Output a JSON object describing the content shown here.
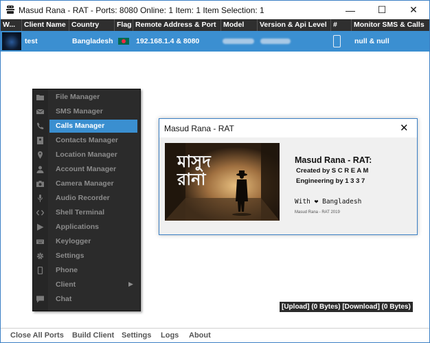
{
  "window": {
    "title": "Masud Rana - RAT - Ports: 8080 Online: 1 Item: 1 Item Selection: 1",
    "controls": {
      "minimize": "—",
      "maximize": "☐",
      "close": "✕"
    }
  },
  "table": {
    "columns": [
      "W...",
      "Client Name",
      "Country",
      "Flag",
      "Remote Address & Port",
      "Model",
      "Version & Api Level",
      "#",
      "Monitor SMS & Calls"
    ],
    "rows": [
      {
        "client_name": "test",
        "country": "Bangladesh",
        "remote": "192.168.1.4 & 8080",
        "monitor": "null & null"
      }
    ]
  },
  "context_menu": {
    "items": [
      {
        "label": "File Manager",
        "icon": "folder-icon"
      },
      {
        "label": "SMS Manager",
        "icon": "envelope-icon"
      },
      {
        "label": "Calls Manager",
        "icon": "phone-icon"
      },
      {
        "label": "Contacts Manager",
        "icon": "address-book-icon"
      },
      {
        "label": "Location Manager",
        "icon": "map-pin-icon"
      },
      {
        "label": "Account Manager",
        "icon": "user-icon"
      },
      {
        "label": "Camera Manager",
        "icon": "camera-icon"
      },
      {
        "label": "Audio Recorder",
        "icon": "microphone-icon"
      },
      {
        "label": "Shell Terminal",
        "icon": "code-icon"
      },
      {
        "label": "Applications",
        "icon": "play-icon"
      },
      {
        "label": "Keylogger",
        "icon": "keyboard-icon"
      },
      {
        "label": "Settings",
        "icon": "gear-icon"
      },
      {
        "label": "Phone",
        "icon": "mobile-icon"
      },
      {
        "label": "Client",
        "icon": "none"
      },
      {
        "label": "Chat",
        "icon": "chat-icon"
      }
    ],
    "selected": "Calls Manager"
  },
  "about_dialog": {
    "title": "Masud Rana - RAT",
    "close": "✕",
    "heading": "Masud Rana - RAT:",
    "credit_line1": "Created by S C R E A M",
    "credit_line2": "Engineering by 1 3 3 7",
    "with_prefix": "With",
    "heart": "❤",
    "with_suffix": "Bangladesh",
    "footer": "Masud Rana - RAT 2019",
    "image_title": "মাসুদ রানা"
  },
  "transfer_status": "[Upload] (0 Bytes) [Download] (0 Bytes)",
  "bottom_menu": [
    "Close All Ports",
    "Build Client",
    "Settings",
    "Logs",
    "About"
  ],
  "colors": {
    "header_bg": "#2f2f2f",
    "row_selected": "#3b8fd1",
    "menu_bg": "#2b2b2b",
    "menu_highlight": "#3a8fd0"
  }
}
